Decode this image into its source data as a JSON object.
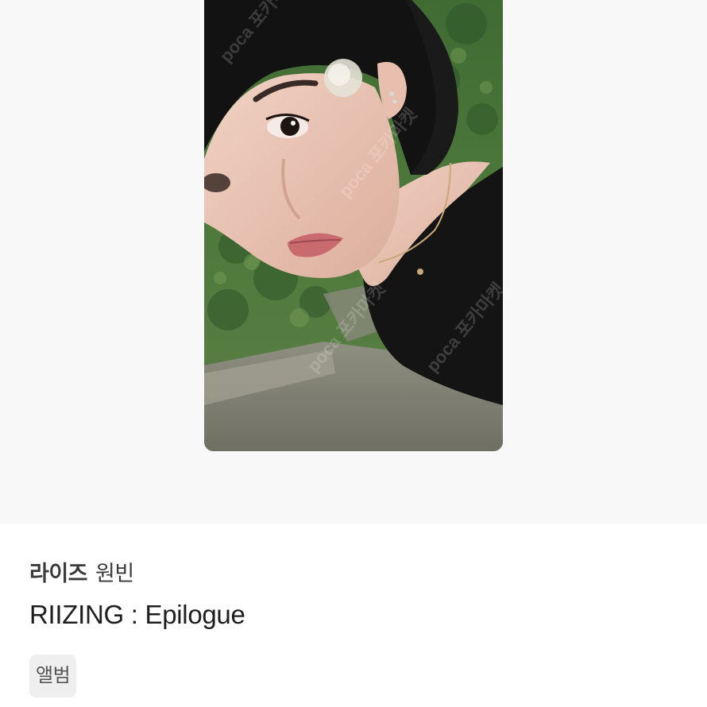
{
  "product": {
    "group": "라이즈",
    "member": "원빈",
    "album": "RIIZING : Epilogue",
    "tag": "앨범"
  },
  "image": {
    "kind": "photocard",
    "subject": "person-portrait"
  },
  "colors": {
    "photo_background": "#f8f8f8",
    "tag_background": "#efefef",
    "text_primary": "#1e1e1e",
    "text_secondary": "#3a3a3a"
  }
}
